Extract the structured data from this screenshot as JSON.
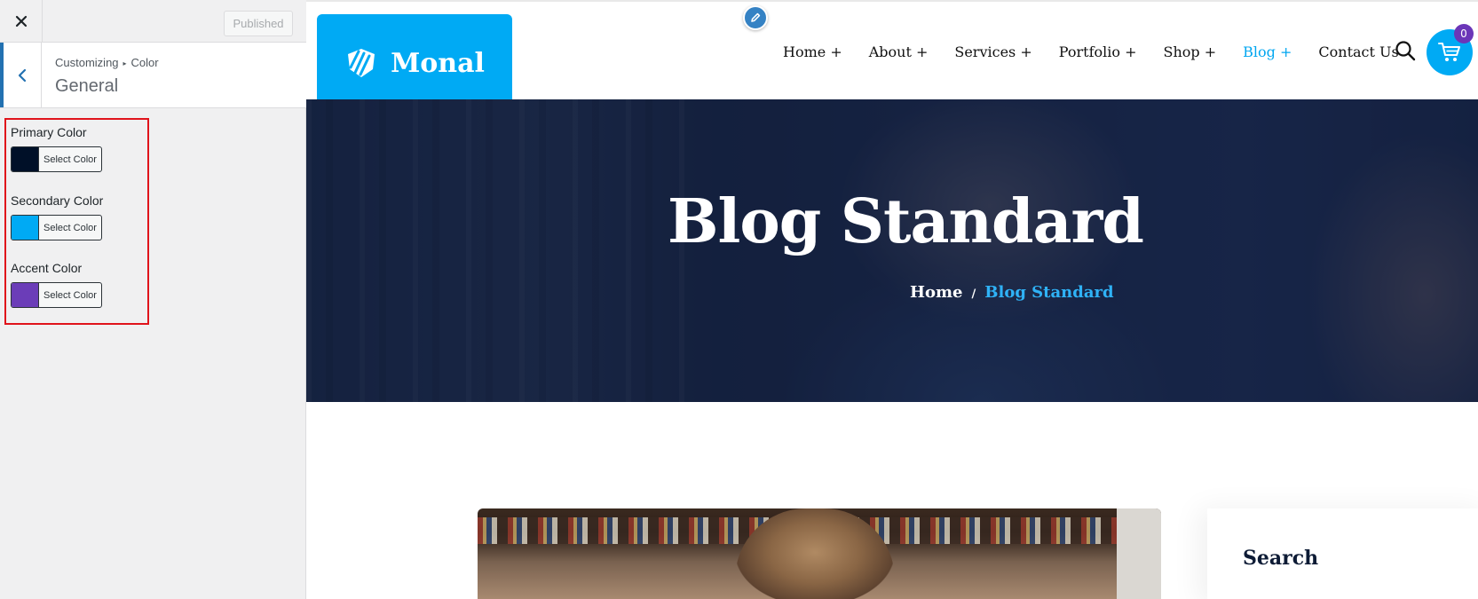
{
  "customizer": {
    "published_label": "Published",
    "breadcrumb": {
      "root": "Customizing",
      "separator": "▸",
      "current": "Color"
    },
    "section_title": "General",
    "controls": [
      {
        "label": "Primary Color",
        "button_label": "Select Color",
        "color": "#001028"
      },
      {
        "label": "Secondary Color",
        "button_label": "Select Color",
        "color": "#00aaf4"
      },
      {
        "label": "Accent Color",
        "button_label": "Select Color",
        "color": "#6b3db8"
      }
    ]
  },
  "site": {
    "logo_text": "Monal",
    "nav": [
      {
        "label": "Home +"
      },
      {
        "label": "About +"
      },
      {
        "label": "Services +"
      },
      {
        "label": "Portfolio +"
      },
      {
        "label": "Shop +"
      },
      {
        "label": "Blog +",
        "active": true
      },
      {
        "label": "Contact Us"
      }
    ],
    "cart_count": "0",
    "hero": {
      "title": "Blog Standard",
      "breadcrumb_home": "Home",
      "breadcrumb_sep": "/",
      "breadcrumb_current": "Blog Standard"
    },
    "sidebar_widget_title": "Search"
  },
  "colors": {
    "brand_blue": "#00aaf4",
    "wp_blue": "#2271b1",
    "highlight_red": "#e0131b",
    "badge_purple": "#6b36b8"
  },
  "icons": [
    "close-icon",
    "chevron-left-icon",
    "pencil-icon",
    "logo-mark-icon",
    "search-icon",
    "cart-icon"
  ]
}
